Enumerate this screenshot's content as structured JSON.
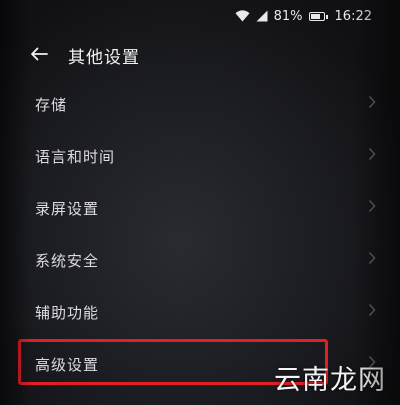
{
  "status_bar": {
    "battery_percent_text": "81%",
    "battery_level": 0.81,
    "time": "16:22",
    "icons": [
      "wifi-icon",
      "cellular-signal-icon",
      "battery-icon"
    ]
  },
  "header": {
    "back_icon": "arrow-left-icon",
    "title": "其他设置"
  },
  "menu": {
    "items": [
      {
        "label": "存储"
      },
      {
        "label": "语言和时间"
      },
      {
        "label": "录屏设置"
      },
      {
        "label": "系统安全"
      },
      {
        "label": "辅助功能"
      },
      {
        "label": "高级设置"
      }
    ],
    "chevron_icon": "chevron-right-icon"
  },
  "annotation": {
    "highlight_color": "#e31e24",
    "highlighted_item": "高级设置"
  },
  "watermark": {
    "text": "云南龙网"
  }
}
